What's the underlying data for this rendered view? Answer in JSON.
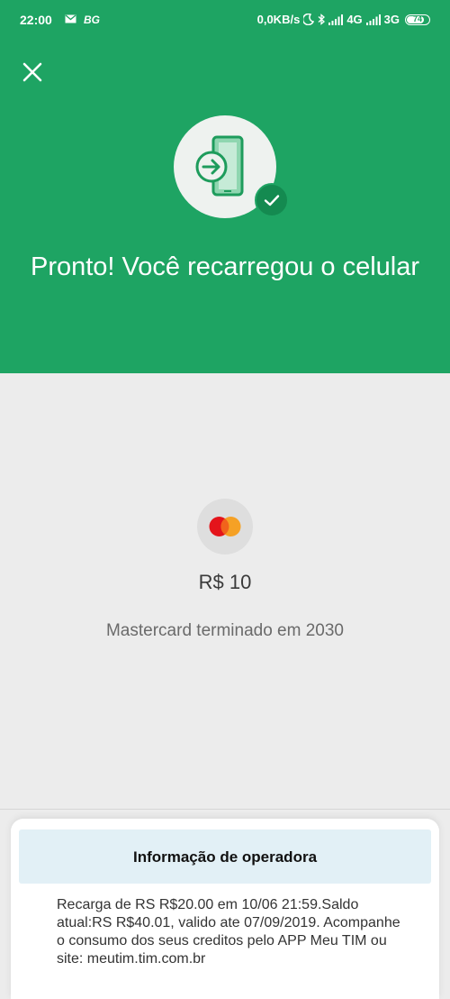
{
  "status_bar": {
    "time": "22:00",
    "carrier_tag": "BG",
    "speed": "0,0KB/s",
    "network_1": "4G",
    "network_2": "3G",
    "battery": "74"
  },
  "header": {
    "title": "Pronto! Você recarregou o celular",
    "background_color": "#1ea463"
  },
  "icons": {
    "close": "close-icon",
    "hero": "phone-recharge-icon",
    "check": "check-icon",
    "card": "mastercard-icon"
  },
  "payment": {
    "amount": "R$ 10",
    "card_description": "Mastercard terminado em 2030"
  },
  "sheet": {
    "title": "Informação de operadora",
    "message": "Recarga de RS R$20.00 em 10/06 21:59.Saldo atual:RS R$40.01, valido ate 07/09/2019. Acompanhe o consumo dos seus creditos pelo APP Meu TIM ou site: meutim.tim.com.br"
  }
}
